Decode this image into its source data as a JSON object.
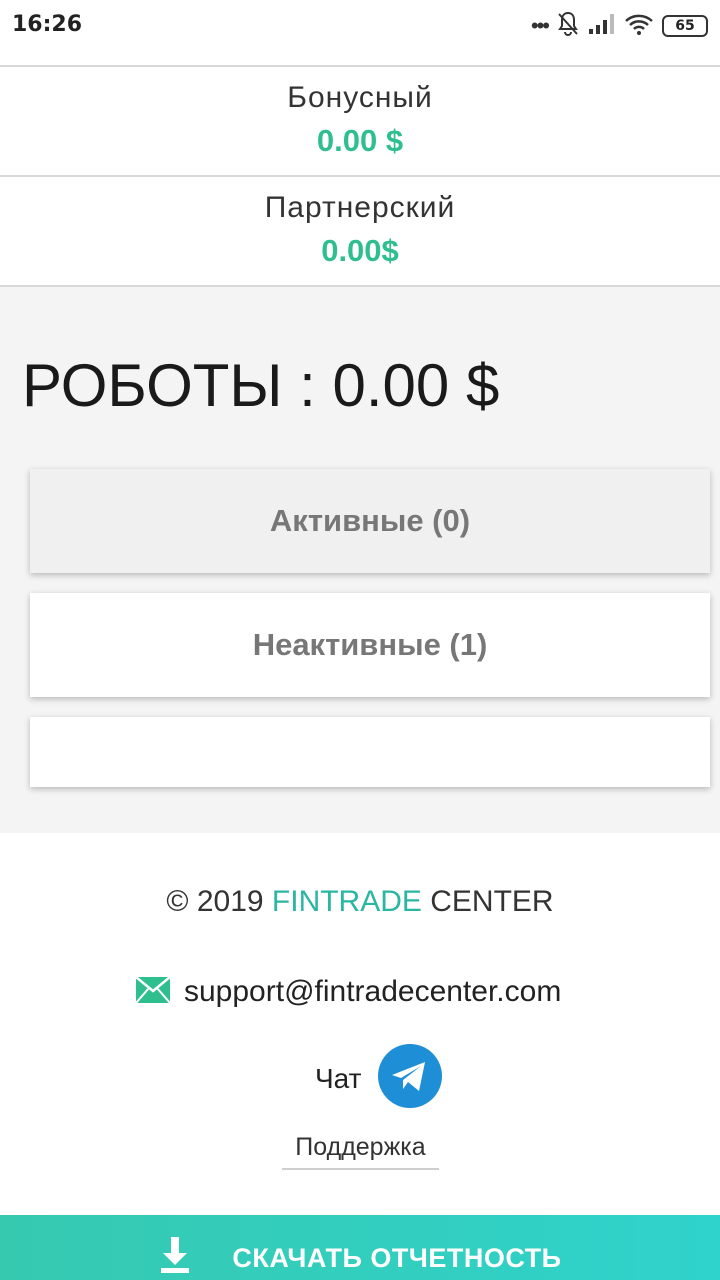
{
  "status_bar": {
    "time": "16:26",
    "battery": "65",
    "icons": [
      "more-dots-icon",
      "bell-muted-icon",
      "signal-icon",
      "wifi-icon",
      "battery-icon"
    ]
  },
  "balances": [
    {
      "label": "Бонусный",
      "value": "0.00 $"
    },
    {
      "label": "Партнерский",
      "value": "0.00$"
    }
  ],
  "robots": {
    "title": "РОБОТЫ : 0.00 $",
    "tabs": [
      {
        "label": "Активные (0)"
      },
      {
        "label": "Неактивные (1)"
      },
      {
        "label": ""
      }
    ]
  },
  "footer": {
    "copyright_prefix": "© 2019 ",
    "brand_accent": "FINTRADE",
    "brand_rest": " CENTER",
    "email": "support@fintradecenter.com",
    "chat_label": "Чат",
    "support_link": "Поддержка"
  },
  "download": {
    "label": "СКАЧАТЬ ОТЧЕТНОСТЬ"
  },
  "colors": {
    "accent_green": "#2fbf8f",
    "brand_teal": "#2bb6a3",
    "telegram_blue": "#1e8fd6",
    "download_gradient_start": "#36c9b0",
    "download_gradient_end": "#2fd3cc"
  }
}
